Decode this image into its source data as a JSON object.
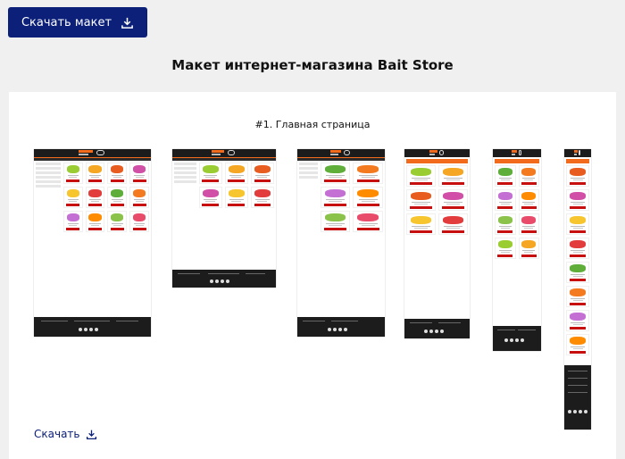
{
  "header": {
    "download_button_label": "Скачать макет",
    "download_icon": "download-icon"
  },
  "page": {
    "title": "Макет интернет-магазина Bait Store"
  },
  "section": {
    "title": "#1. Главная страница",
    "thumbnail_views": [
      "desktop-large",
      "desktop-medium",
      "laptop",
      "tablet",
      "mobile-large",
      "mobile-small"
    ],
    "download_link_label": "Скачать"
  },
  "colors": {
    "accent": "#0c2079",
    "brand_orange": "#f26b1d",
    "buy_button": "#c70f0f",
    "header_dark": "#1c1c1c"
  },
  "lure_colors": [
    "#9acd32",
    "#f5a623",
    "#e85d1f",
    "#d14fa6",
    "#f7c52e",
    "#e23c3c",
    "#5fae3a",
    "#f47a20",
    "#c46fd3",
    "#ff8c00",
    "#8bc34a",
    "#e94b6b"
  ]
}
